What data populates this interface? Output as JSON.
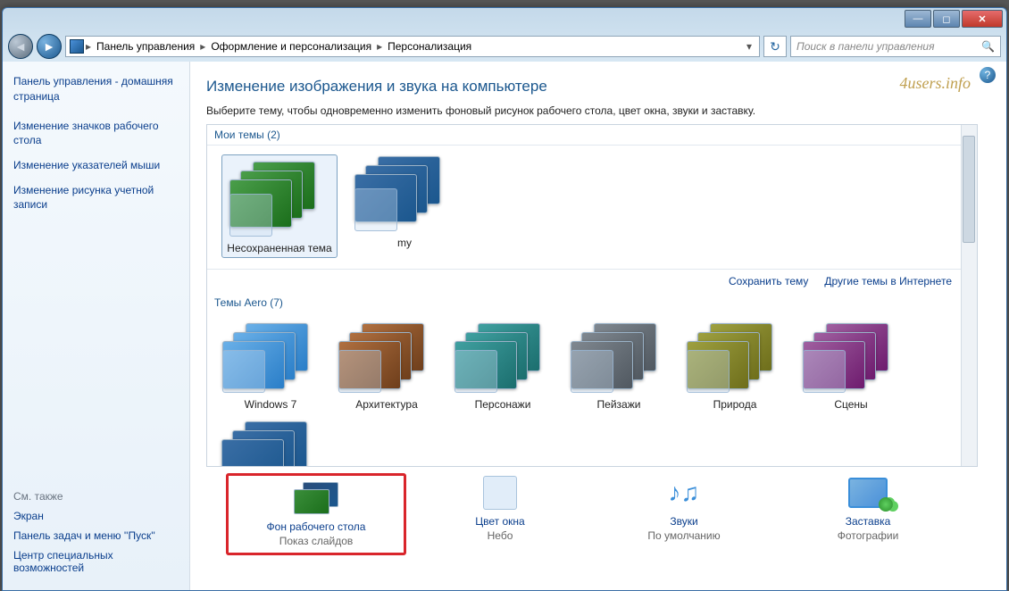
{
  "titlebar": {
    "min": "—",
    "max": "◻",
    "close": "✕"
  },
  "breadcrumb": {
    "items": [
      "Панель управления",
      "Оформление и персонализация",
      "Персонализация"
    ]
  },
  "search_placeholder": "Поиск в панели управления",
  "sidebar": {
    "home": "Панель управления - домашняя страница",
    "links": [
      "Изменение значков рабочего стола",
      "Изменение указателей мыши",
      "Изменение рисунка учетной записи"
    ],
    "see_also_hdr": "См. также",
    "see_also": [
      "Экран",
      "Панель задач и меню ''Пуск''",
      "Центр специальных возможностей"
    ]
  },
  "main": {
    "watermark": "4users.info",
    "title": "Изменение изображения и звука на компьютере",
    "subtitle": "Выберите тему, чтобы одновременно изменить фоновый рисунок рабочего стола, цвет окна, звуки и заставку.",
    "group1_hdr": "Мои темы (2)",
    "my_themes": [
      {
        "label": "Несохраненная тема",
        "selected": true,
        "variant": "c-green"
      },
      {
        "label": "my",
        "selected": false,
        "variant": "c-blue"
      }
    ],
    "save_link": "Сохранить тему",
    "more_link": "Другие темы в Интернете",
    "group2_hdr": "Темы Aero (7)",
    "aero_themes": [
      {
        "label": "Windows 7",
        "variant": "c-win7"
      },
      {
        "label": "Архитектура",
        "variant": "c-brown"
      },
      {
        "label": "Персонажи",
        "variant": "c-teal"
      },
      {
        "label": "Пейзажи",
        "variant": "c-gray"
      },
      {
        "label": "Природа",
        "variant": "c-olive"
      },
      {
        "label": "Сцены",
        "variant": "c-purple"
      }
    ]
  },
  "bottom": [
    {
      "title": "Фон рабочего стола",
      "sub": "Показ слайдов",
      "highlight": true,
      "icon": "desktop"
    },
    {
      "title": "Цвет окна",
      "sub": "Небо",
      "highlight": false,
      "icon": "color"
    },
    {
      "title": "Звуки",
      "sub": "По умолчанию",
      "highlight": false,
      "icon": "sound"
    },
    {
      "title": "Заставка",
      "sub": "Фотографии",
      "highlight": false,
      "icon": "screensaver"
    }
  ]
}
